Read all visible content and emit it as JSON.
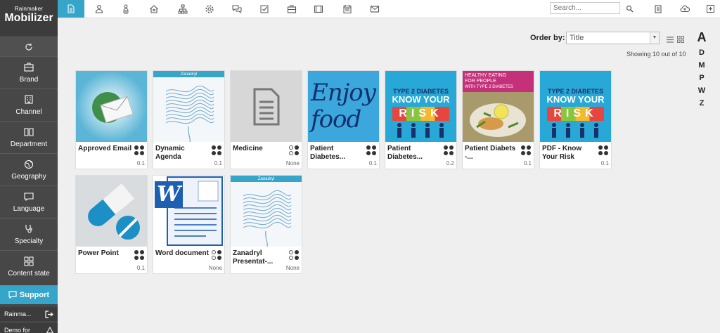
{
  "app": {
    "brand_small": "Rainmaker",
    "brand_big": "Mobilizer"
  },
  "sidebar": {
    "items": [
      {
        "label": "Brand",
        "icon": "briefcase-icon"
      },
      {
        "label": "Channel",
        "icon": "building-icon"
      },
      {
        "label": "Department",
        "icon": "book-icon"
      },
      {
        "label": "Geography",
        "icon": "globe-icon"
      },
      {
        "label": "Language",
        "icon": "speech-bubble-icon"
      },
      {
        "label": "Specialty",
        "icon": "stethoscope-icon"
      },
      {
        "label": "Content state",
        "icon": "grid-icon"
      }
    ],
    "support_label": "Support",
    "user_label": "Rainma...",
    "demo_label": "Demo for"
  },
  "topbar": {
    "search_placeholder": "Search...",
    "tabs": [
      "document",
      "person",
      "person-tree",
      "house",
      "org-chart",
      "gear",
      "chat",
      "checklist",
      "briefcase",
      "film",
      "calendar",
      "envelope"
    ]
  },
  "toolbar": {
    "order_label": "Order by:",
    "order_value": "Title",
    "showing_text": "Showing 10 out of 10"
  },
  "alphabet": [
    "A",
    "D",
    "M",
    "P",
    "W",
    "Z"
  ],
  "cards": [
    {
      "title": "Approved Email",
      "version": "0.1",
      "status": "full",
      "thumb": "email"
    },
    {
      "title": "Dynamic Agenda",
      "version": "0.1",
      "status": "full",
      "thumb": "brain",
      "brand": "Zanadryl"
    },
    {
      "title": "Medicine",
      "version": "None",
      "status": "half",
      "thumb": "doc"
    },
    {
      "title": "Patient Diabetes...",
      "version": "0.1",
      "status": "full",
      "thumb": "enjoy",
      "art": "Enjoy food"
    },
    {
      "title": "Patient Diabetes...",
      "version": "0.2",
      "status": "full",
      "thumb": "risk",
      "art1": "TYPE 2 DIABETES",
      "art2": "KNOW YOUR",
      "art3": "RISK"
    },
    {
      "title": "Patient Diabets -...",
      "version": "0.1",
      "status": "full",
      "thumb": "healthy",
      "art1": "HEALTHY EATING",
      "art2": "FOR PEOPLE",
      "art3": "WITH TYPE 2 DIABETES"
    },
    {
      "title": "PDF - Know Your Risk",
      "version": "0.1",
      "status": "full",
      "thumb": "risk",
      "art1": "TYPE 2 DIABETES",
      "art2": "KNOW YOUR",
      "art3": "RISK"
    },
    {
      "title": "Power Point",
      "version": "0.1",
      "status": "full",
      "thumb": "pill"
    },
    {
      "title": "Word document",
      "version": "None",
      "status": "half",
      "thumb": "word",
      "art": "W"
    },
    {
      "title": "Zanadryl Presentat-...",
      "version": "None",
      "status": "half",
      "thumb": "brain",
      "brand": "Zanadryl"
    }
  ],
  "colors": {
    "accent": "#35a5c9",
    "sidebar": "#474747"
  }
}
